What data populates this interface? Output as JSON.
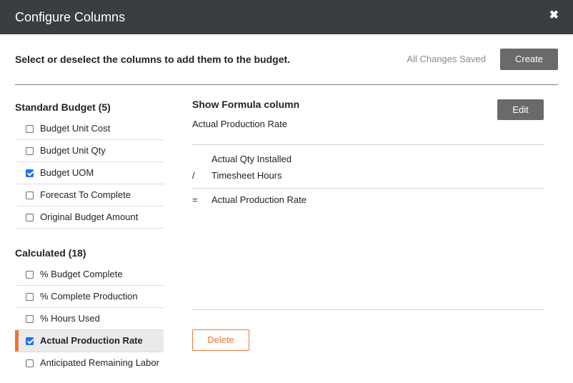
{
  "dialog": {
    "title": "Configure Columns",
    "close_symbol": "✖"
  },
  "toolbar": {
    "instruction": "Select or deselect the columns to add them to the budget.",
    "status": "All Changes Saved",
    "create_label": "Create"
  },
  "standard": {
    "title": "Standard Budget (5)",
    "items": [
      {
        "label": "Budget Unit Cost",
        "checked": false
      },
      {
        "label": "Budget Unit Qty",
        "checked": false
      },
      {
        "label": "Budget UOM",
        "checked": true
      },
      {
        "label": "Forecast To Complete",
        "checked": false
      },
      {
        "label": "Original Budget Amount",
        "checked": false
      }
    ]
  },
  "calculated": {
    "title": "Calculated (18)",
    "items": [
      {
        "label": "% Budget Complete",
        "checked": false
      },
      {
        "label": "% Complete Production",
        "checked": false
      },
      {
        "label": "% Hours Used",
        "checked": false
      },
      {
        "label": "Actual Production Rate",
        "checked": true,
        "selected": true
      },
      {
        "label": "Anticipated Remaining Labor",
        "checked": false
      }
    ]
  },
  "formula": {
    "heading": "Show Formula column",
    "column_name": "Actual Production Rate",
    "edit_label": "Edit",
    "rows": [
      {
        "op": "",
        "value": "Actual Qty Installed"
      },
      {
        "op": "/",
        "value": "Timesheet Hours"
      },
      {
        "op": "=",
        "value": "Actual Production Rate"
      }
    ],
    "delete_label": "Delete"
  },
  "colors": {
    "header_bg": "#3b3e40",
    "accent": "#e87838",
    "checkbox_checked": "#1a73e8",
    "button_dark": "#6a6a6a"
  }
}
